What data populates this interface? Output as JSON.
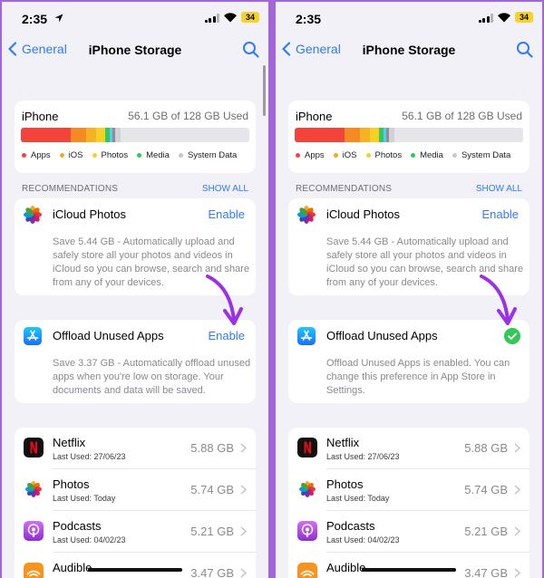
{
  "status": {
    "time": "2:35",
    "battery": "34"
  },
  "nav": {
    "back_label": "General",
    "title": "iPhone Storage"
  },
  "storage": {
    "device": "iPhone",
    "used_text": "56.1 GB of 128 GB Used",
    "legend": [
      "Apps",
      "iOS",
      "Photos",
      "Media",
      "System Data"
    ],
    "colors": {
      "apps": "#f2443a",
      "ios": "#f5a623",
      "photos": "#f7d026",
      "media": "#34c759",
      "system": "#c7c7cc"
    }
  },
  "recommendations": {
    "header": "RECOMMENDATIONS",
    "show_all": "SHOW ALL",
    "icloud": {
      "title": "iCloud Photos",
      "action": "Enable",
      "desc": "Save 5.44 GB - Automatically upload and safely store all your photos and videos in iCloud so you can browse, search and share from any of your devices."
    },
    "offload_before": {
      "title": "Offload Unused Apps",
      "action": "Enable",
      "desc": "Save 3.37 GB - Automatically offload unused apps when you're low on storage. Your documents and data will be saved."
    },
    "offload_after": {
      "title": "Offload Unused Apps",
      "desc": "Offload Unused Apps is enabled. You can change this preference in App Store in Settings."
    }
  },
  "apps": [
    {
      "name": "Netflix",
      "last_used": "Last Used: 27/06/23",
      "size": "5.88 GB"
    },
    {
      "name": "Photos",
      "last_used": "Last Used: Today",
      "size": "5.74 GB"
    },
    {
      "name": "Podcasts",
      "last_used": "Last Used: 04/02/23",
      "size": "5.21 GB"
    },
    {
      "name": "Audible",
      "last_used": "",
      "size": "3.47 GB"
    }
  ],
  "accent_color": "#2f7cf6",
  "annotation_arrow_color": "#9b30e6"
}
